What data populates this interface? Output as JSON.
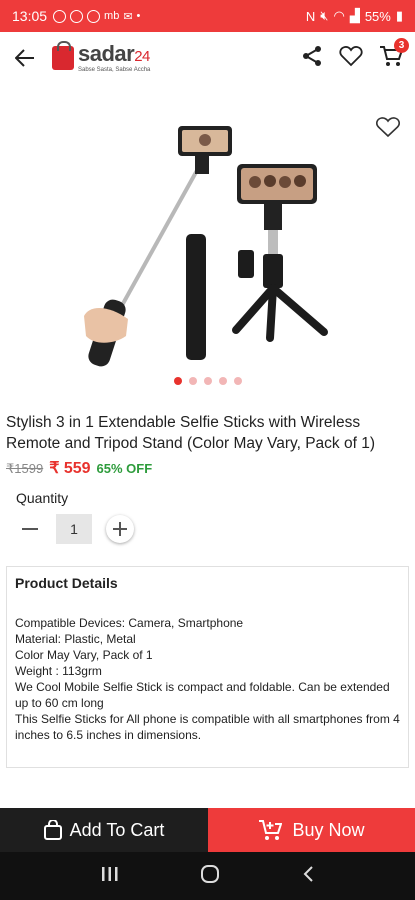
{
  "status_bar": {
    "time": "13:05",
    "app_icons": [
      "facebook-icon",
      "messenger-icon",
      "skype-icon"
    ],
    "small_labels": [
      "mb"
    ],
    "battery": "55%"
  },
  "header": {
    "logo_text": "sadar",
    "logo_number": "24",
    "logo_tagline": "Sabse Sasta, Sabse Accha",
    "cart_count": "3"
  },
  "product": {
    "image_count": 5,
    "active_image": 0,
    "title": "Stylish 3 in 1 Extendable Selfie Sticks with Wireless Remote and Tripod Stand (Color May Vary, Pack of 1)",
    "mrp": "₹1599",
    "price": "₹ 559",
    "discount": "65% OFF"
  },
  "quantity": {
    "label": "Quantity",
    "value": "1"
  },
  "details": {
    "title": "Product Details",
    "lines": [
      "Compatible Devices: Camera, Smartphone",
      "Material: Plastic, Metal",
      "Color May Vary, Pack of 1",
      "Weight : 113grm",
      "We Cool Mobile Selfie Stick is compact and foldable. Can be extended up to 60 cm long",
      "This Selfie Sticks for All phone is compatible with all smartphones from 4 inches to 6.5 inches in dimensions."
    ]
  },
  "actions": {
    "add_to_cart": "Add To Cart",
    "buy_now": "Buy Now"
  },
  "colors": {
    "accent": "#ee3b3b",
    "dark": "#1e1e1e",
    "discount_green": "#2e9c3c"
  }
}
